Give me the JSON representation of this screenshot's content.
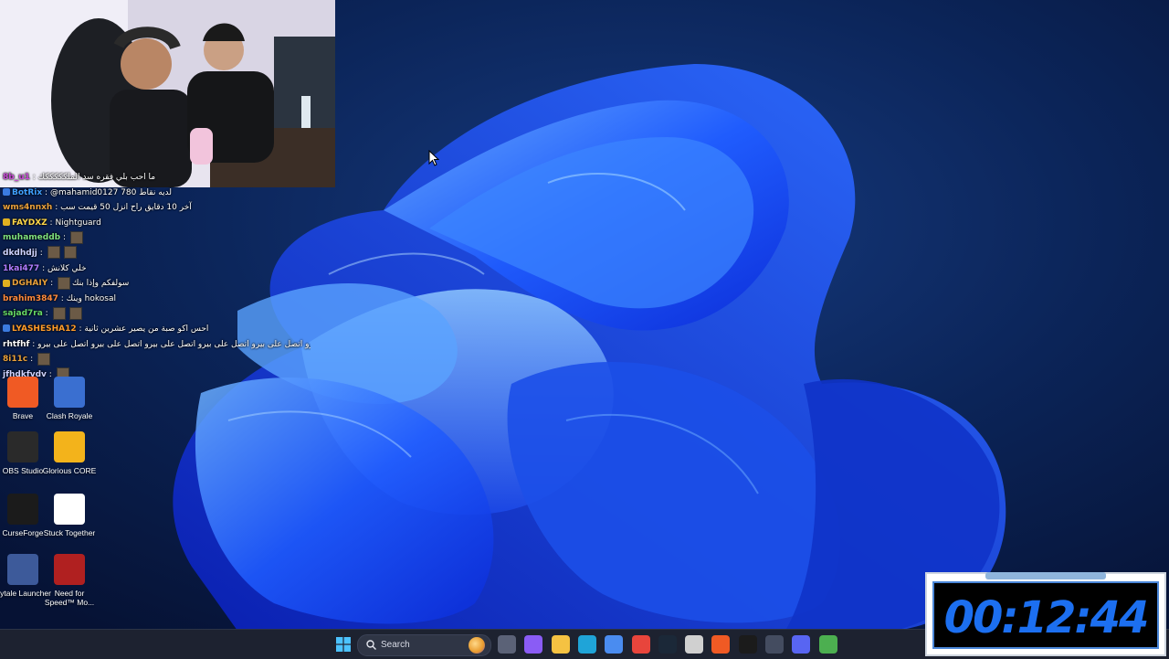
{
  "webcam": {
    "label": ""
  },
  "chat": [
    {
      "name": "8b_u1",
      "name_color": "#c94bd8",
      "message": "ما احب بلي فقره سد الملكككككك",
      "emotes": 0
    },
    {
      "name": "BotRix",
      "name_color": "#3fa0ff",
      "message": "@mahamid0127 780 لديه نقاط",
      "emotes": 0,
      "badge_color": "#3b7be0"
    },
    {
      "name": "wms4nnxh",
      "name_color": "#e9a03b",
      "message": "آخر 10 دقايق راح انزل 50 قيمت سب",
      "emotes": 0
    },
    {
      "name": "FAYDXZ",
      "name_color": "#ffd84a",
      "message": "Nightguard",
      "emotes": 0,
      "badge_color": "#e0b020"
    },
    {
      "name": "muhameddb",
      "name_color": "#7ee07e",
      "message": "",
      "emotes": 1
    },
    {
      "name": "dkdhdjj",
      "name_color": "#cfd3ff",
      "message": "",
      "emotes": 2
    },
    {
      "name": "1kai477",
      "name_color": "#b07cff",
      "message": "خلي كلانش",
      "emotes": 0
    },
    {
      "name": "DGHAIY",
      "name_color": "#e9a03b",
      "message": "سولفكم وإذا بنك",
      "emotes": 1,
      "badge_color": "#e0b020"
    },
    {
      "name": "brahim3847",
      "name_color": "#ff8a3d",
      "message": "وينك hokosal",
      "emotes": 0
    },
    {
      "name": "sajad7ra",
      "name_color": "#66d966",
      "message": "",
      "emotes": 2
    },
    {
      "name": "LYASHESHA12",
      "name_color": "#ff9c2a",
      "message": "احس اكو صبة من يصير عشرين ثانية",
      "emotes": 0,
      "badge_color": "#3b7be0"
    },
    {
      "name": "rhtfhf",
      "name_color": "#ffffff",
      "message": "اتصل على بيرو اتصل على بيرو اتصل على بيرو اتصل على بيرو اتصل على بيرو اتصل على بيرو",
      "emotes": 0
    },
    {
      "name": "8i11c",
      "name_color": "#e9a03b",
      "message": "",
      "emotes": 1
    },
    {
      "name": "jfhdkfvdv",
      "name_color": "#cfd3ff",
      "message": "",
      "emotes": 1
    }
  ],
  "desktop_icons": [
    {
      "label": "Brave",
      "icon": "brave-icon",
      "color": "#f05a24"
    },
    {
      "label": "Clash Royale",
      "icon": "clash-royale-icon",
      "color": "#3a6fd0"
    },
    {
      "label": "OBS Studio",
      "icon": "obs-icon",
      "color": "#2a2a2a"
    },
    {
      "label": "Glorious CORE",
      "icon": "glorious-icon",
      "color": "#f3b31b"
    },
    {
      "label": "CurseForge",
      "icon": "curseforge-icon",
      "color": "#1b1b1b"
    },
    {
      "label": "Stuck Together",
      "icon": "file-icon",
      "color": "#ffffff"
    },
    {
      "label": "Hytale Launcher",
      "icon": "hytale-icon",
      "color": "#3d5a9a"
    },
    {
      "label": "Need for Speed™ Mo...",
      "icon": "nfs-icon",
      "color": "#b02020"
    }
  ],
  "taskbar": {
    "search_placeholder": "Search",
    "apps": [
      {
        "name": "task-view-icon",
        "color": "#5b6277"
      },
      {
        "name": "copilot-icon",
        "color": "#8a5cf5"
      },
      {
        "name": "file-explorer-icon",
        "color": "#f5c242"
      },
      {
        "name": "edge-icon",
        "color": "#1fa4d8"
      },
      {
        "name": "microsoft-store-icon",
        "color": "#4a8cf0"
      },
      {
        "name": "chrome-icon",
        "color": "#e8453c"
      },
      {
        "name": "steam-icon",
        "color": "#1b2838"
      },
      {
        "name": "steelseries-icon",
        "color": "#d0d0d0"
      },
      {
        "name": "brave-icon",
        "color": "#f05a24"
      },
      {
        "name": "curseforge-icon",
        "color": "#1b1b1b"
      },
      {
        "name": "app-icon",
        "color": "#444c60"
      },
      {
        "name": "discord-icon",
        "color": "#5865f2"
      },
      {
        "name": "package-icon",
        "color": "#4caf50"
      }
    ]
  },
  "timer": {
    "value": "00:12:44"
  },
  "colors": {
    "wallpaper_dark": "#07163a",
    "bloom_blue": "#1a5cff",
    "taskbar": "#1d2230"
  }
}
